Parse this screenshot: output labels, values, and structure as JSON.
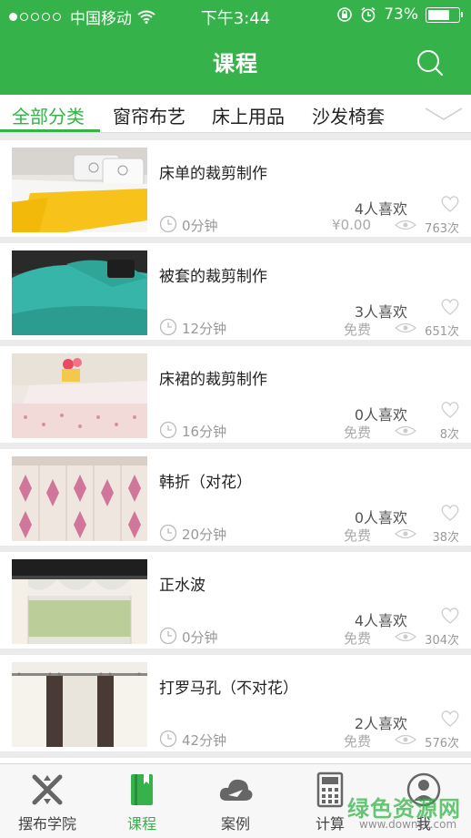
{
  "status_bar": {
    "carrier": "中国移动",
    "time": "下午3:44",
    "battery": "73%"
  },
  "header": {
    "title": "课程"
  },
  "tabs": [
    "全部分类",
    "窗帘布艺",
    "床上用品",
    "沙发椅套",
    "​"
  ],
  "courses": [
    {
      "title": "床单的裁剪制作",
      "likes": "4人喜欢",
      "duration": "0分钟",
      "price": "¥0.00",
      "views": "763次"
    },
    {
      "title": "被套的裁剪制作",
      "likes": "3人喜欢",
      "duration": "12分钟",
      "price": "免费",
      "views": "651次"
    },
    {
      "title": "床裙的裁剪制作",
      "likes": "0人喜欢",
      "duration": "16分钟",
      "price": "免费",
      "views": "8次"
    },
    {
      "title": "韩折（对花）",
      "likes": "0人喜欢",
      "duration": "20分钟",
      "price": "免费",
      "views": "38次"
    },
    {
      "title": "正水波",
      "likes": "4人喜欢",
      "duration": "0分钟",
      "price": "免费",
      "views": "304次"
    },
    {
      "title": "打罗马孔（不对花）",
      "likes": "2人喜欢",
      "duration": "42分钟",
      "price": "免费",
      "views": "576次"
    }
  ],
  "bottom_nav": [
    {
      "label": "摆布学院",
      "icon": "cross-tools-icon"
    },
    {
      "label": "课程",
      "icon": "book-icon",
      "active": true
    },
    {
      "label": "案例",
      "icon": "cloud-icon"
    },
    {
      "label": "计算",
      "icon": "calculator-icon"
    },
    {
      "label": "我",
      "icon": "user-icon"
    }
  ],
  "watermark": {
    "text": "绿色资源网",
    "sub": "www.downcc.com"
  },
  "colors": {
    "primary": "#35b34a",
    "background": "#ebebeb"
  }
}
